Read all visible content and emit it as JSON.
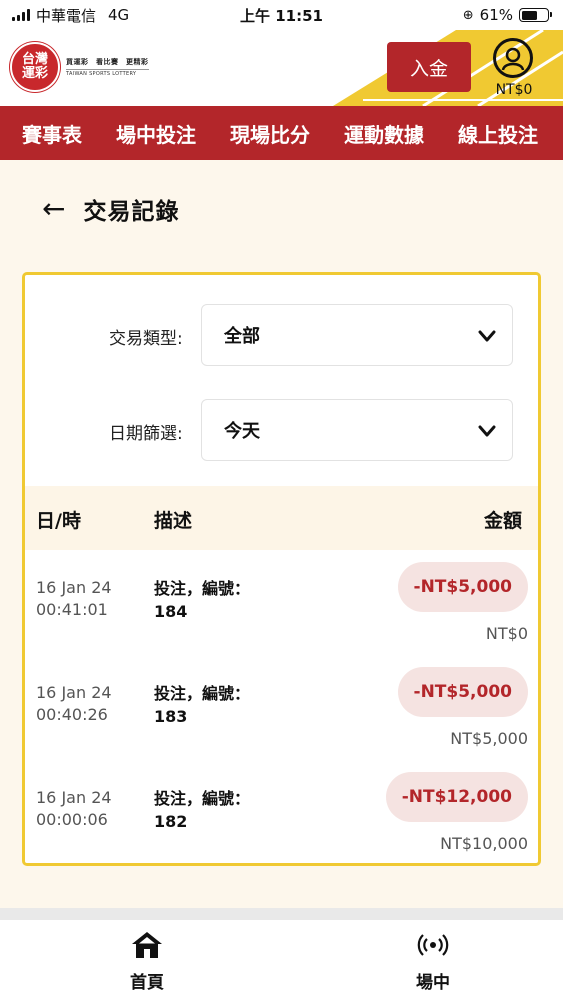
{
  "status_bar": {
    "carrier": "中華電信",
    "network": "4G",
    "time": "上午 11:51",
    "battery": "61%"
  },
  "header": {
    "logo": {
      "name_line1": "台灣",
      "name_line2": "運彩",
      "slogan": "買運彩　看比賽　更精彩",
      "english": "TAIWAN SPORTS LOTTERY"
    },
    "deposit_label": "入金",
    "balance": "NT$0"
  },
  "nav": {
    "items": [
      "賽事表",
      "場中投注",
      "現場比分",
      "運動數據",
      "線上投注"
    ]
  },
  "page": {
    "back_icon": "←",
    "title": "交易記錄"
  },
  "filters": {
    "type_label": "交易類型:",
    "type_value": "全部",
    "date_label": "日期篩選:",
    "date_value": "今天"
  },
  "table": {
    "headers": {
      "datetime": "日/時",
      "description": "描述",
      "amount": "金額"
    },
    "rows": [
      {
        "date": "16 Jan 24",
        "time": "00:41:01",
        "desc_line1": "投注，編號：",
        "desc_line2": "184",
        "amount": "-NT$5,000",
        "balance": "NT$0"
      },
      {
        "date": "16 Jan 24",
        "time": "00:40:26",
        "desc_line1": "投注，編號：",
        "desc_line2": "183",
        "amount": "-NT$5,000",
        "balance": "NT$5,000"
      },
      {
        "date": "16 Jan 24",
        "time": "00:00:06",
        "desc_line1": "投注，編號：",
        "desc_line2": "182",
        "amount": "-NT$12,000",
        "balance": "NT$10,000"
      }
    ]
  },
  "bottom_nav": {
    "home_label": "首頁",
    "live_label": "場中"
  },
  "colors": {
    "brand_red": "#b3262a",
    "accent_yellow": "#f0c932",
    "amount_pill": "#f5e3e1",
    "page_bg": "#fdf7ec"
  }
}
